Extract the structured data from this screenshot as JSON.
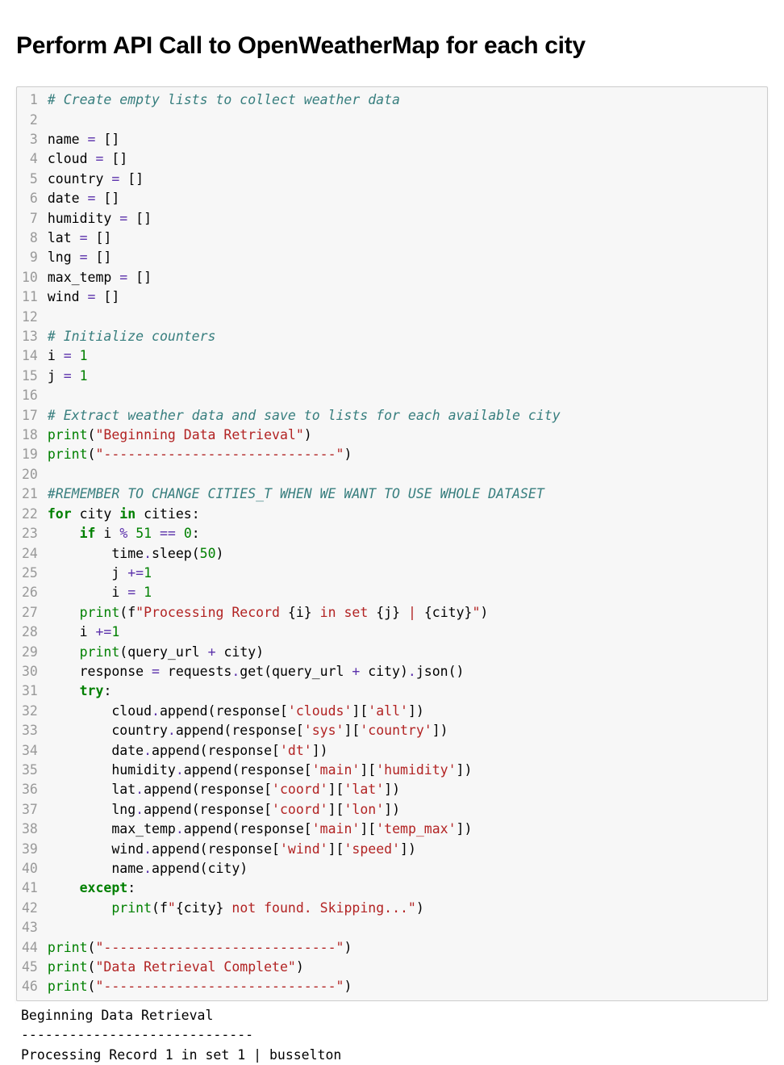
{
  "heading": "Perform API Call to OpenWeatherMap for each city",
  "code": {
    "lineCount": 46,
    "lines": [
      [
        {
          "cls": "c",
          "t": "# Create empty lists to collect weather data"
        }
      ],
      [],
      [
        {
          "cls": "n",
          "t": "name "
        },
        {
          "cls": "o",
          "t": "="
        },
        {
          "cls": "n",
          "t": " []"
        }
      ],
      [
        {
          "cls": "n",
          "t": "cloud "
        },
        {
          "cls": "o",
          "t": "="
        },
        {
          "cls": "n",
          "t": " []"
        }
      ],
      [
        {
          "cls": "n",
          "t": "country "
        },
        {
          "cls": "o",
          "t": "="
        },
        {
          "cls": "n",
          "t": " []"
        }
      ],
      [
        {
          "cls": "n",
          "t": "date "
        },
        {
          "cls": "o",
          "t": "="
        },
        {
          "cls": "n",
          "t": " []"
        }
      ],
      [
        {
          "cls": "n",
          "t": "humidity "
        },
        {
          "cls": "o",
          "t": "="
        },
        {
          "cls": "n",
          "t": " []"
        }
      ],
      [
        {
          "cls": "n",
          "t": "lat "
        },
        {
          "cls": "o",
          "t": "="
        },
        {
          "cls": "n",
          "t": " []"
        }
      ],
      [
        {
          "cls": "n",
          "t": "lng "
        },
        {
          "cls": "o",
          "t": "="
        },
        {
          "cls": "n",
          "t": " []"
        }
      ],
      [
        {
          "cls": "n",
          "t": "max_temp "
        },
        {
          "cls": "o",
          "t": "="
        },
        {
          "cls": "n",
          "t": " []"
        }
      ],
      [
        {
          "cls": "n",
          "t": "wind "
        },
        {
          "cls": "o",
          "t": "="
        },
        {
          "cls": "n",
          "t": " []"
        }
      ],
      [],
      [
        {
          "cls": "c",
          "t": "# Initialize counters"
        }
      ],
      [
        {
          "cls": "n",
          "t": "i "
        },
        {
          "cls": "o",
          "t": "="
        },
        {
          "cls": "n",
          "t": " "
        },
        {
          "cls": "m",
          "t": "1"
        }
      ],
      [
        {
          "cls": "n",
          "t": "j "
        },
        {
          "cls": "o",
          "t": "="
        },
        {
          "cls": "n",
          "t": " "
        },
        {
          "cls": "m",
          "t": "1"
        }
      ],
      [],
      [
        {
          "cls": "c",
          "t": "# Extract weather data and save to lists for each available city"
        }
      ],
      [
        {
          "cls": "kn",
          "t": "print"
        },
        {
          "cls": "p",
          "t": "("
        },
        {
          "cls": "s",
          "t": "\"Beginning Data Retrieval\""
        },
        {
          "cls": "p",
          "t": ")"
        }
      ],
      [
        {
          "cls": "kn",
          "t": "print"
        },
        {
          "cls": "p",
          "t": "("
        },
        {
          "cls": "s",
          "t": "\"-----------------------------\""
        },
        {
          "cls": "p",
          "t": ")"
        }
      ],
      [],
      [
        {
          "cls": "c",
          "t": "#REMEMBER TO CHANGE CITIES_T WHEN WE WANT TO USE WHOLE DATASET"
        }
      ],
      [
        {
          "cls": "k",
          "t": "for"
        },
        {
          "cls": "n",
          "t": " city "
        },
        {
          "cls": "k",
          "t": "in"
        },
        {
          "cls": "n",
          "t": " cities:"
        }
      ],
      [
        {
          "cls": "n",
          "t": "    "
        },
        {
          "cls": "k",
          "t": "if"
        },
        {
          "cls": "n",
          "t": " i "
        },
        {
          "cls": "o",
          "t": "%"
        },
        {
          "cls": "n",
          "t": " "
        },
        {
          "cls": "m",
          "t": "51"
        },
        {
          "cls": "n",
          "t": " "
        },
        {
          "cls": "o",
          "t": "=="
        },
        {
          "cls": "n",
          "t": " "
        },
        {
          "cls": "m",
          "t": "0"
        },
        {
          "cls": "p",
          "t": ":"
        }
      ],
      [
        {
          "cls": "n",
          "t": "        time"
        },
        {
          "cls": "o",
          "t": "."
        },
        {
          "cls": "n",
          "t": "sleep("
        },
        {
          "cls": "m",
          "t": "50"
        },
        {
          "cls": "p",
          "t": ")"
        }
      ],
      [
        {
          "cls": "n",
          "t": "        j "
        },
        {
          "cls": "o",
          "t": "+="
        },
        {
          "cls": "m",
          "t": "1"
        }
      ],
      [
        {
          "cls": "n",
          "t": "        i "
        },
        {
          "cls": "o",
          "t": "="
        },
        {
          "cls": "n",
          "t": " "
        },
        {
          "cls": "m",
          "t": "1"
        }
      ],
      [
        {
          "cls": "n",
          "t": "    "
        },
        {
          "cls": "kn",
          "t": "print"
        },
        {
          "cls": "p",
          "t": "(f"
        },
        {
          "cls": "s",
          "t": "\"Processing Record "
        },
        {
          "cls": "p",
          "t": "{i}"
        },
        {
          "cls": "s",
          "t": " in set "
        },
        {
          "cls": "p",
          "t": "{j}"
        },
        {
          "cls": "s",
          "t": " | "
        },
        {
          "cls": "p",
          "t": "{city}"
        },
        {
          "cls": "s",
          "t": "\""
        },
        {
          "cls": "p",
          "t": ")"
        }
      ],
      [
        {
          "cls": "n",
          "t": "    i "
        },
        {
          "cls": "o",
          "t": "+="
        },
        {
          "cls": "m",
          "t": "1"
        }
      ],
      [
        {
          "cls": "n",
          "t": "    "
        },
        {
          "cls": "kn",
          "t": "print"
        },
        {
          "cls": "p",
          "t": "(query_url "
        },
        {
          "cls": "o",
          "t": "+"
        },
        {
          "cls": "p",
          "t": " city)"
        }
      ],
      [
        {
          "cls": "n",
          "t": "    response "
        },
        {
          "cls": "o",
          "t": "="
        },
        {
          "cls": "n",
          "t": " requests"
        },
        {
          "cls": "o",
          "t": "."
        },
        {
          "cls": "n",
          "t": "get(query_url "
        },
        {
          "cls": "o",
          "t": "+"
        },
        {
          "cls": "n",
          "t": " city)"
        },
        {
          "cls": "o",
          "t": "."
        },
        {
          "cls": "n",
          "t": "json()"
        }
      ],
      [
        {
          "cls": "n",
          "t": "    "
        },
        {
          "cls": "k",
          "t": "try"
        },
        {
          "cls": "p",
          "t": ":"
        }
      ],
      [
        {
          "cls": "n",
          "t": "        cloud"
        },
        {
          "cls": "o",
          "t": "."
        },
        {
          "cls": "n",
          "t": "append(response["
        },
        {
          "cls": "s",
          "t": "'clouds'"
        },
        {
          "cls": "n",
          "t": "]["
        },
        {
          "cls": "s",
          "t": "'all'"
        },
        {
          "cls": "n",
          "t": "])"
        }
      ],
      [
        {
          "cls": "n",
          "t": "        country"
        },
        {
          "cls": "o",
          "t": "."
        },
        {
          "cls": "n",
          "t": "append(response["
        },
        {
          "cls": "s",
          "t": "'sys'"
        },
        {
          "cls": "n",
          "t": "]["
        },
        {
          "cls": "s",
          "t": "'country'"
        },
        {
          "cls": "n",
          "t": "])"
        }
      ],
      [
        {
          "cls": "n",
          "t": "        date"
        },
        {
          "cls": "o",
          "t": "."
        },
        {
          "cls": "n",
          "t": "append(response["
        },
        {
          "cls": "s",
          "t": "'dt'"
        },
        {
          "cls": "n",
          "t": "])"
        }
      ],
      [
        {
          "cls": "n",
          "t": "        humidity"
        },
        {
          "cls": "o",
          "t": "."
        },
        {
          "cls": "n",
          "t": "append(response["
        },
        {
          "cls": "s",
          "t": "'main'"
        },
        {
          "cls": "n",
          "t": "]["
        },
        {
          "cls": "s",
          "t": "'humidity'"
        },
        {
          "cls": "n",
          "t": "])"
        }
      ],
      [
        {
          "cls": "n",
          "t": "        lat"
        },
        {
          "cls": "o",
          "t": "."
        },
        {
          "cls": "n",
          "t": "append(response["
        },
        {
          "cls": "s",
          "t": "'coord'"
        },
        {
          "cls": "n",
          "t": "]["
        },
        {
          "cls": "s",
          "t": "'lat'"
        },
        {
          "cls": "n",
          "t": "])"
        }
      ],
      [
        {
          "cls": "n",
          "t": "        lng"
        },
        {
          "cls": "o",
          "t": "."
        },
        {
          "cls": "n",
          "t": "append(response["
        },
        {
          "cls": "s",
          "t": "'coord'"
        },
        {
          "cls": "n",
          "t": "]["
        },
        {
          "cls": "s",
          "t": "'lon'"
        },
        {
          "cls": "n",
          "t": "])"
        }
      ],
      [
        {
          "cls": "n",
          "t": "        max_temp"
        },
        {
          "cls": "o",
          "t": "."
        },
        {
          "cls": "n",
          "t": "append(response["
        },
        {
          "cls": "s",
          "t": "'main'"
        },
        {
          "cls": "n",
          "t": "]["
        },
        {
          "cls": "s",
          "t": "'temp_max'"
        },
        {
          "cls": "n",
          "t": "])"
        }
      ],
      [
        {
          "cls": "n",
          "t": "        wind"
        },
        {
          "cls": "o",
          "t": "."
        },
        {
          "cls": "n",
          "t": "append(response["
        },
        {
          "cls": "s",
          "t": "'wind'"
        },
        {
          "cls": "n",
          "t": "]["
        },
        {
          "cls": "s",
          "t": "'speed'"
        },
        {
          "cls": "n",
          "t": "])"
        }
      ],
      [
        {
          "cls": "n",
          "t": "        name"
        },
        {
          "cls": "o",
          "t": "."
        },
        {
          "cls": "n",
          "t": "append(city)"
        }
      ],
      [
        {
          "cls": "n",
          "t": "    "
        },
        {
          "cls": "k",
          "t": "except"
        },
        {
          "cls": "p",
          "t": ":"
        }
      ],
      [
        {
          "cls": "n",
          "t": "        "
        },
        {
          "cls": "kn",
          "t": "print"
        },
        {
          "cls": "p",
          "t": "(f"
        },
        {
          "cls": "s",
          "t": "\""
        },
        {
          "cls": "p",
          "t": "{city}"
        },
        {
          "cls": "s",
          "t": " not found. Skipping...\""
        },
        {
          "cls": "p",
          "t": ")"
        }
      ],
      [],
      [
        {
          "cls": "kn",
          "t": "print"
        },
        {
          "cls": "p",
          "t": "("
        },
        {
          "cls": "s",
          "t": "\"-----------------------------\""
        },
        {
          "cls": "p",
          "t": ")"
        }
      ],
      [
        {
          "cls": "kn",
          "t": "print"
        },
        {
          "cls": "p",
          "t": "("
        },
        {
          "cls": "s",
          "t": "\"Data Retrieval Complete\""
        },
        {
          "cls": "p",
          "t": ")"
        }
      ],
      [
        {
          "cls": "kn",
          "t": "print"
        },
        {
          "cls": "p",
          "t": "("
        },
        {
          "cls": "s",
          "t": "\"-----------------------------\""
        },
        {
          "cls": "p",
          "t": ")"
        }
      ]
    ]
  },
  "output": "Beginning Data Retrieval\n-----------------------------\nProcessing Record 1 in set 1 | busselton"
}
